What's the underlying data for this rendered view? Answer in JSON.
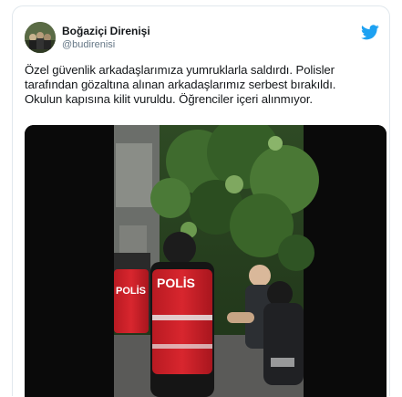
{
  "tweet": {
    "display_name": "Boğaziçi Direnişi",
    "handle": "@budirenisi",
    "text_lines": [
      "Özel güvenlik arkadaşlarımıza yumruklarla saldırdı. Polisler",
      "tarafından gözaltına alınan arkadaşlarımız serbest bırakıldı.",
      "Okulun kapısına kilit vuruldu. Öğrenciler içeri alınmıyor."
    ]
  },
  "media": {
    "vest_label_left": "POLİS",
    "vest_label_right": "POLİS"
  },
  "icons": {
    "brand": "twitter-bird-icon"
  },
  "colors": {
    "twitter_blue": "#1da1f2",
    "vest_red": "#d0202a",
    "text_primary": "#14171a",
    "text_secondary": "#657786"
  }
}
